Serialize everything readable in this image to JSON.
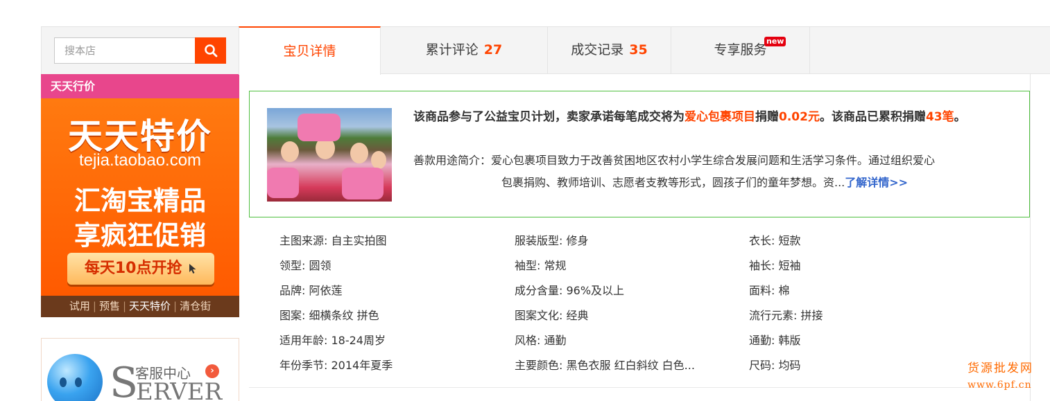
{
  "search": {
    "placeholder": "搜本店"
  },
  "banner": {
    "header": "天天行价",
    "headline": "天天特价",
    "url": "tejia.taobao.com",
    "line1": "汇淘宝精品",
    "line2": "享疯狂促销",
    "cta": "每天10点开抢",
    "footer_links": [
      "试用",
      "预售",
      "天天特价",
      "清仓街"
    ],
    "footer_sep": "|"
  },
  "service": {
    "title": "客服中心",
    "arrow": "›",
    "word_initial": "S",
    "word_rest": "ERVER"
  },
  "tabs": [
    {
      "label": "宝贝详情",
      "count": ""
    },
    {
      "label": "累计评论",
      "count": "27"
    },
    {
      "label": "成交记录",
      "count": "35"
    },
    {
      "label": "专享服务",
      "badge": "new"
    }
  ],
  "charity": {
    "line_a": "该商品参与了公益宝贝计划，卖家承诺每笔成交将为",
    "project": "爱心包裹项目",
    "line_b": "捐赠",
    "amount": "0.02元",
    "line_c": "。该商品已累积捐赠",
    "count": "43笔",
    "line_d": "。",
    "intro_lead": "善款用途简介：爱心包裹项目致力于改善贫困地区农村小学生综合发展问题和生活学习条件。通过组织爱心",
    "intro_cont": "包裹捐购、教师培训、志愿者支教等形式，圆孩子们的童年梦想。资...",
    "more": "了解详情>>"
  },
  "attributes": [
    [
      "主图来源: 自主实拍图",
      "服装版型: 修身",
      "衣长: 短款"
    ],
    [
      "领型: 圆领",
      "袖型: 常规",
      "袖长: 短袖"
    ],
    [
      "品牌: 阿依莲",
      "成分含量: 96%及以上",
      "面料: 棉"
    ],
    [
      "图案: 细横条纹 拼色",
      "图案文化: 经典",
      "流行元素: 拼接"
    ],
    [
      "适用年龄: 18-24周岁",
      "风格: 通勤",
      "通勤: 韩版"
    ],
    [
      "年份季节: 2014年夏季",
      "主要颜色: 黑色衣服 红白斜纹 白色...",
      "尺码: 均码"
    ]
  ],
  "watermark": {
    "line1": "货源批发网",
    "line2": "www.6pf.cn"
  },
  "colors": {
    "accent": "#ff4400",
    "charity_border": "#4fbf3f",
    "link": "#3366cc",
    "banner": "#ff6a00",
    "banner_head": "#e8468c"
  }
}
